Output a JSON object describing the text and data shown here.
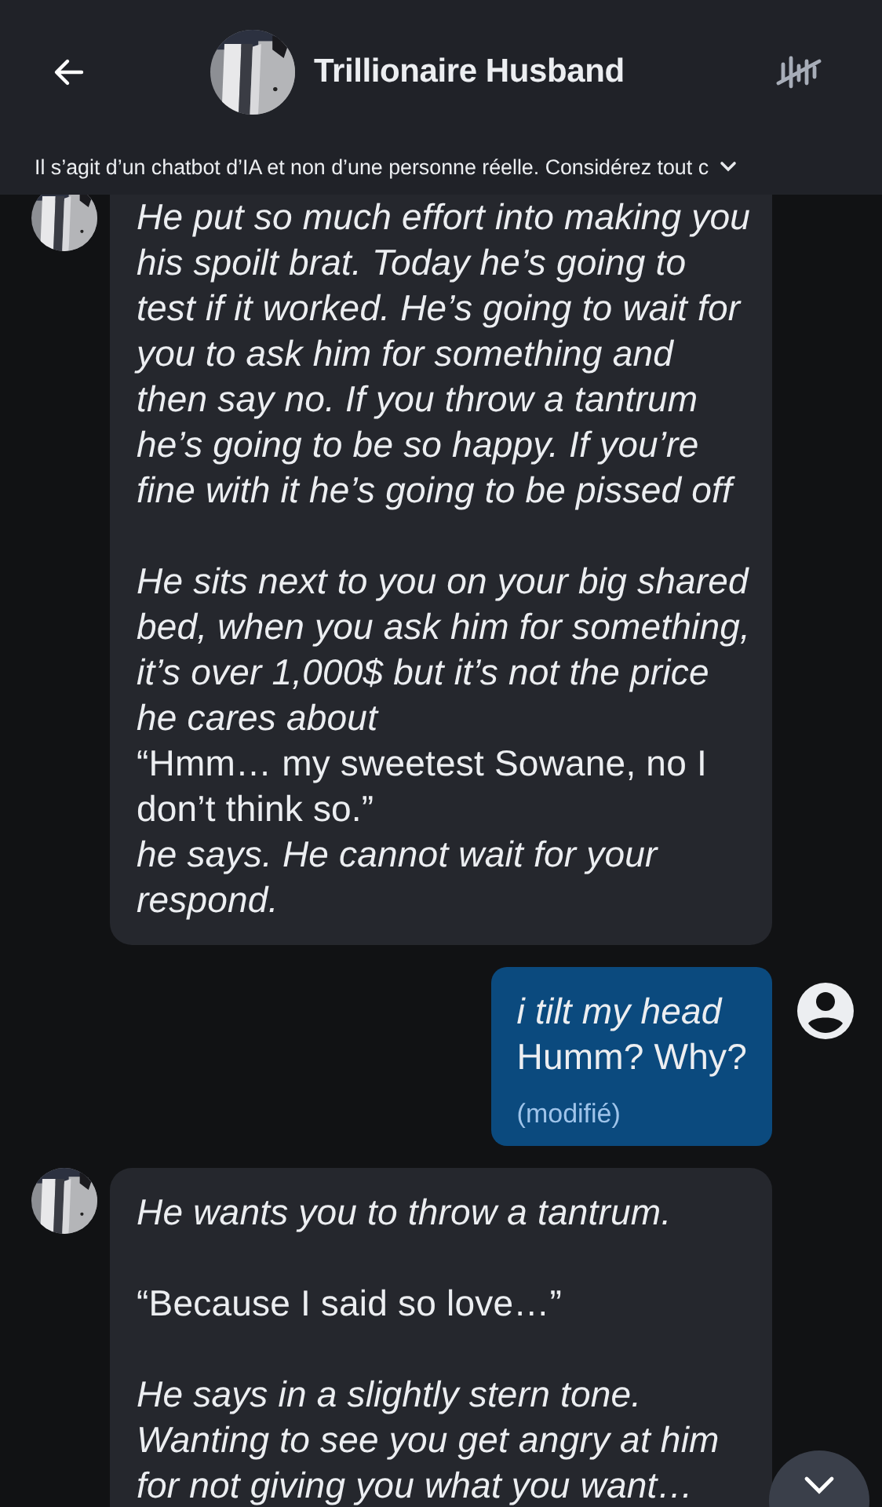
{
  "header": {
    "title": "Trillionaire Husband"
  },
  "disclaimer": {
    "text": "Il s’agit d’un chatbot d’IA et non d’une personne réelle. Considérez tout c",
    "expanded": false
  },
  "messages": [
    {
      "kind": "bot",
      "paragraphs": [
        [
          {
            "kind": "narration",
            "text": "He put so much effort into making you his spoilt brat. Today he’s going to test if it worked. He’s going to wait for you to ask him for something and then say no. If you throw a tantrum he’s going to be so happy. If you’re fine with it he’s going to be pissed off"
          }
        ],
        [
          {
            "kind": "narration",
            "text": "He sits next to you on your big shared bed, when you ask him for something, it’s over 1,000$ but it’s not the price he cares about"
          },
          {
            "kind": "speech",
            "text": "“Hmm… my sweetest Sowane, no I don’t think so.”"
          },
          {
            "kind": "narration",
            "text": "he says. He cannot wait for your respond."
          }
        ]
      ]
    },
    {
      "kind": "user",
      "edited_label": "(modifié)",
      "paragraphs": [
        [
          {
            "kind": "narration",
            "text": "i tilt my head"
          },
          {
            "kind": "speech",
            "text": "Humm? Why?"
          }
        ]
      ]
    },
    {
      "kind": "bot",
      "paragraphs": [
        [
          {
            "kind": "narration",
            "text": "He wants you to throw a tantrum."
          }
        ],
        [
          {
            "kind": "speech",
            "text": "“Because I said so love…”"
          }
        ],
        [
          {
            "kind": "narration",
            "text": "He says in a slightly stern tone."
          },
          {
            "kind": "narration",
            "text": "Wanting to see you get angry at him for not giving you what you want…"
          }
        ]
      ]
    }
  ]
}
